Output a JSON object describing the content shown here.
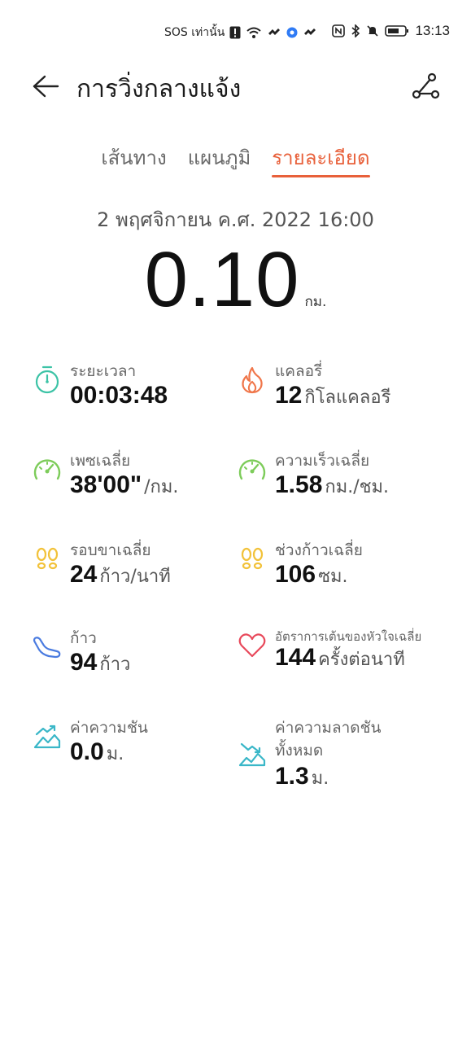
{
  "status_bar": {
    "carrier_text": "SOS เท่านั้น",
    "time": "13:13"
  },
  "header": {
    "title": "การวิ่งกลางแจ้ง"
  },
  "tabs": [
    {
      "label": "เส้นทาง",
      "active": false
    },
    {
      "label": "แผนภูมิ",
      "active": false
    },
    {
      "label": "รายละเอียด",
      "active": true
    }
  ],
  "date": "2 พฤศจิกายน ค.ศ. 2022 16:00",
  "distance": {
    "value": "0.10",
    "unit": "กม."
  },
  "colors": {
    "accent": "#e8603a",
    "duration_icon": "#3cc3a6",
    "calorie_icon": "#f0764a",
    "pace_icon": "#7dcc5a",
    "cadence_icon": "#f2c23a",
    "steps_icon": "#4a7be0",
    "heart_icon": "#e8485a",
    "elevation_icon": "#3ab7c8"
  },
  "metrics": {
    "duration": {
      "label": "ระยะเวลา",
      "value": "00:03:48",
      "unit": "",
      "icon": "stopwatch-icon"
    },
    "calories": {
      "label": "แคลอรี่",
      "value": "12",
      "unit": "กิโลแคลอรี",
      "icon": "flame-icon"
    },
    "pace": {
      "label": "เพซเฉลี่ย",
      "value": "38'00\"",
      "unit": "/กม.",
      "icon": "speedometer-icon"
    },
    "speed": {
      "label": "ความเร็วเฉลี่ย",
      "value": "1.58",
      "unit": "กม./ชม.",
      "icon": "speedometer-icon"
    },
    "cadence": {
      "label": "รอบขาเฉลี่ย",
      "value": "24",
      "unit": "ก้าว/นาที",
      "icon": "footprints-icon"
    },
    "stride": {
      "label": "ช่วงก้าวเฉลี่ย",
      "value": "106",
      "unit": "ซม.",
      "icon": "footprints-icon"
    },
    "steps": {
      "label": "ก้าว",
      "value": "94",
      "unit": "ก้าว",
      "icon": "shoe-icon"
    },
    "heart_rate": {
      "label": "อัตราการเต้นของหัวใจเฉลี่ย",
      "value": "144",
      "unit": "ครั้งต่อนาที",
      "icon": "heart-icon"
    },
    "ascent": {
      "label": "ค่าความชัน",
      "value": "0.0",
      "unit": "ม.",
      "icon": "mountain-up-icon"
    },
    "descent": {
      "label": "ค่าความลาดชันทั้งหมด",
      "label_line1": "ค่าความลาดชัน",
      "label_line2": "ทั้งหมด",
      "value": "1.3",
      "unit": "ม.",
      "icon": "mountain-down-icon"
    }
  }
}
